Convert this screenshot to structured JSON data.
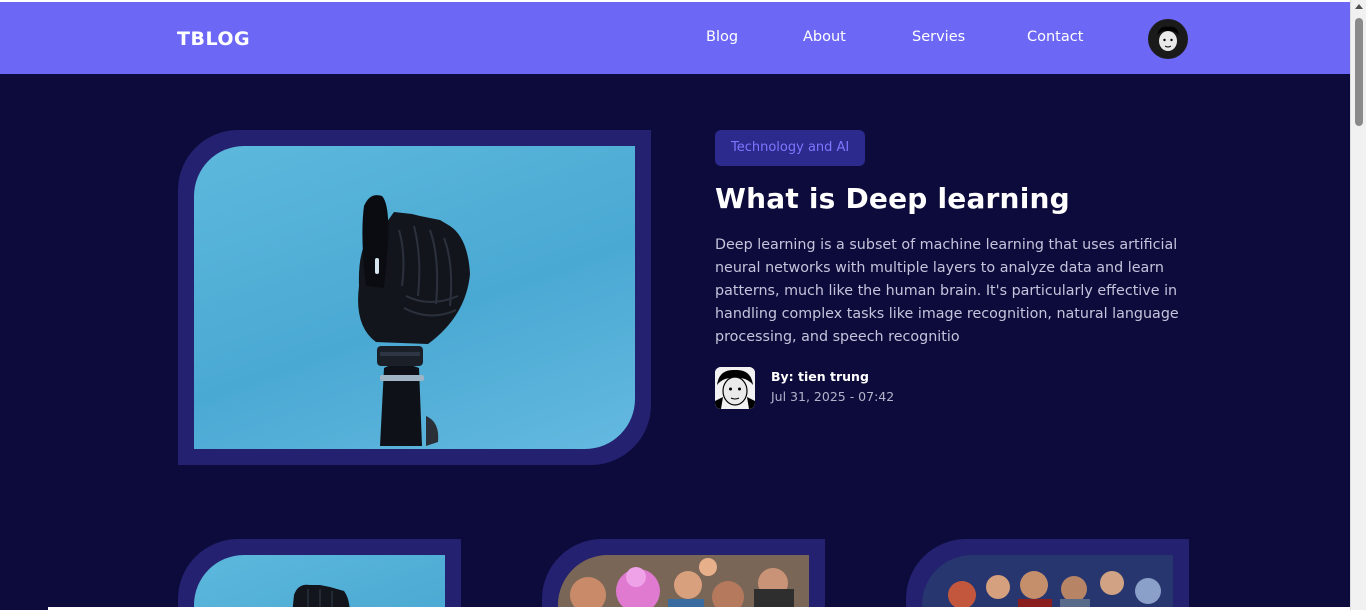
{
  "header": {
    "logo": "TBLOG",
    "nav": [
      "Blog",
      "About",
      "Servies",
      "Contact"
    ],
    "avatar_icon": "user-avatar-icon"
  },
  "featured": {
    "category": "Technology and AI",
    "title": "What is Deep learning",
    "description": "Deep learning is a subset of machine learning that uses artificial neural networks with multiple layers to analyze data and learn patterns, much like the human brain. It's particularly effective in handling complex tasks like image recognition, natural language processing, and speech recognitio",
    "author": "By: tien trung",
    "date": "Jul 31, 2025 - 07:42"
  },
  "colors": {
    "header_bg": "#6c68f5",
    "page_bg": "#0d0b3b",
    "frame": "#242170",
    "tag_bg": "#2c2a8c",
    "tag_text": "#7b77ff"
  }
}
